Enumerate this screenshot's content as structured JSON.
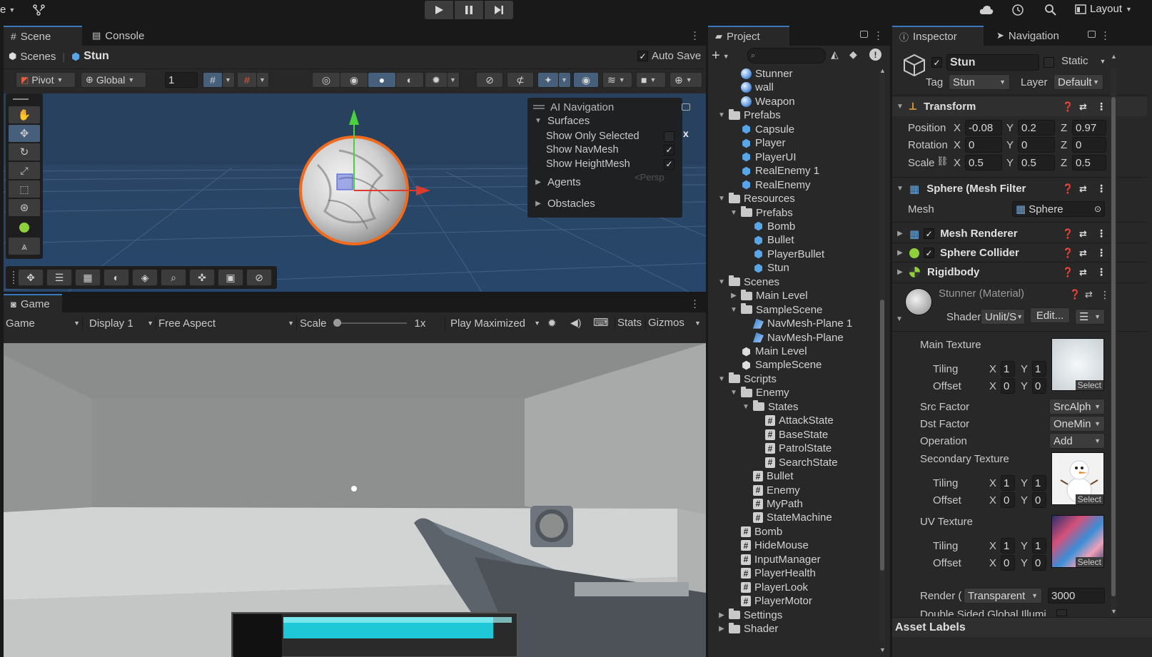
{
  "topbar": {
    "account_menu": "e",
    "layout_label": "Layout"
  },
  "scene_panel": {
    "tabs": [
      {
        "label": "Scene"
      },
      {
        "label": "Console"
      }
    ],
    "breadcrumb_root": "Scenes",
    "breadcrumb_current": "Stun",
    "auto_save_label": "Auto Save",
    "auto_save_checked": true,
    "pivot_label": "Pivot",
    "global_label": "Global",
    "grid_size": "1"
  },
  "ai_navigation": {
    "title": "AI Navigation",
    "surfaces_label": "Surfaces",
    "options": [
      {
        "label": "Show Only Selected",
        "checked": false
      },
      {
        "label": "Show NavMesh",
        "checked": true
      },
      {
        "label": "Show HeightMesh",
        "checked": true
      }
    ],
    "agents_label": "Agents",
    "obstacles_label": "Obstacles",
    "persp_label": "<Persp",
    "close_label": "x"
  },
  "game_panel": {
    "tab_label": "Game",
    "mode": "Game",
    "display": "Display 1",
    "aspect": "Free Aspect",
    "scale_label": "Scale",
    "scale_value": "1x",
    "play_mode": "Play Maximized",
    "stats_label": "Stats",
    "gizmos_label": "Gizmos",
    "health_fraction": 0.92
  },
  "project_panel": {
    "tab_label": "Project",
    "search_placeholder": "",
    "items": [
      {
        "label": "Stunner",
        "icon": "material",
        "depth": 1,
        "arrow": ""
      },
      {
        "label": "wall",
        "icon": "material",
        "depth": 1,
        "arrow": ""
      },
      {
        "label": "Weapon",
        "icon": "material",
        "depth": 1,
        "arrow": ""
      },
      {
        "label": "Prefabs",
        "icon": "folder",
        "depth": 0,
        "arrow": "down"
      },
      {
        "label": "Capsule",
        "icon": "prefab",
        "depth": 1,
        "arrow": ""
      },
      {
        "label": "Player",
        "icon": "prefab",
        "depth": 1,
        "arrow": ""
      },
      {
        "label": "PlayerUI",
        "icon": "prefab",
        "depth": 1,
        "arrow": ""
      },
      {
        "label": "RealEnemy 1",
        "icon": "prefab",
        "depth": 1,
        "arrow": ""
      },
      {
        "label": "RealEnemy",
        "icon": "prefab",
        "depth": 1,
        "arrow": ""
      },
      {
        "label": "Resources",
        "icon": "folder",
        "depth": 0,
        "arrow": "down"
      },
      {
        "label": "Prefabs",
        "icon": "folder",
        "depth": 1,
        "arrow": "down"
      },
      {
        "label": "Bomb",
        "icon": "prefab",
        "depth": 2,
        "arrow": ""
      },
      {
        "label": "Bullet",
        "icon": "prefab",
        "depth": 2,
        "arrow": ""
      },
      {
        "label": "PlayerBullet",
        "icon": "prefab",
        "depth": 2,
        "arrow": ""
      },
      {
        "label": "Stun",
        "icon": "prefab",
        "depth": 2,
        "arrow": ""
      },
      {
        "label": "Scenes",
        "icon": "folder",
        "depth": 0,
        "arrow": "down"
      },
      {
        "label": "Main Level",
        "icon": "folder",
        "depth": 1,
        "arrow": "right"
      },
      {
        "label": "SampleScene",
        "icon": "folder",
        "depth": 1,
        "arrow": "down"
      },
      {
        "label": "NavMesh-Plane 1",
        "icon": "navmesh",
        "depth": 2,
        "arrow": ""
      },
      {
        "label": "NavMesh-Plane",
        "icon": "navmesh",
        "depth": 2,
        "arrow": ""
      },
      {
        "label": "Main Level",
        "icon": "scene",
        "depth": 1,
        "arrow": ""
      },
      {
        "label": "SampleScene",
        "icon": "scene",
        "depth": 1,
        "arrow": ""
      },
      {
        "label": "Scripts",
        "icon": "folder",
        "depth": 0,
        "arrow": "down"
      },
      {
        "label": "Enemy",
        "icon": "folder",
        "depth": 1,
        "arrow": "down"
      },
      {
        "label": "States",
        "icon": "folder",
        "depth": 2,
        "arrow": "down"
      },
      {
        "label": "AttackState",
        "icon": "script",
        "depth": 3,
        "arrow": ""
      },
      {
        "label": "BaseState",
        "icon": "script",
        "depth": 3,
        "arrow": ""
      },
      {
        "label": "PatrolState",
        "icon": "script",
        "depth": 3,
        "arrow": ""
      },
      {
        "label": "SearchState",
        "icon": "script",
        "depth": 3,
        "arrow": ""
      },
      {
        "label": "Bullet",
        "icon": "script",
        "depth": 2,
        "arrow": ""
      },
      {
        "label": "Enemy",
        "icon": "script",
        "depth": 2,
        "arrow": ""
      },
      {
        "label": "MyPath",
        "icon": "script",
        "depth": 2,
        "arrow": ""
      },
      {
        "label": "StateMachine",
        "icon": "script",
        "depth": 2,
        "arrow": ""
      },
      {
        "label": "Bomb",
        "icon": "script",
        "depth": 1,
        "arrow": ""
      },
      {
        "label": "HideMouse",
        "icon": "script",
        "depth": 1,
        "arrow": ""
      },
      {
        "label": "InputManager",
        "icon": "script",
        "depth": 1,
        "arrow": ""
      },
      {
        "label": "PlayerHealth",
        "icon": "script",
        "depth": 1,
        "arrow": ""
      },
      {
        "label": "PlayerLook",
        "icon": "script",
        "depth": 1,
        "arrow": ""
      },
      {
        "label": "PlayerMotor",
        "icon": "script",
        "depth": 1,
        "arrow": ""
      },
      {
        "label": "Settings",
        "icon": "folder",
        "depth": 0,
        "arrow": "right"
      },
      {
        "label": "Shader",
        "icon": "folder",
        "depth": 0,
        "arrow": "right"
      }
    ]
  },
  "inspector": {
    "tabs": [
      {
        "label": "Inspector"
      },
      {
        "label": "Navigation"
      }
    ],
    "object_name": "Stun",
    "object_active": true,
    "static_label": "Static",
    "tag_label": "Tag",
    "tag_value": "Stun",
    "layer_label": "Layer",
    "layer_value": "Default",
    "transform": {
      "title": "Transform",
      "position_label": "Position",
      "rotation_label": "Rotation",
      "scale_label": "Scale",
      "position": {
        "x": "-0.08",
        "y": "0.2",
        "z": "0.97"
      },
      "rotation": {
        "x": "0",
        "y": "0",
        "z": "0"
      },
      "scale": {
        "x": "0.5",
        "y": "0.5",
        "z": "0.5"
      }
    },
    "axis_labels": {
      "x": "X",
      "y": "Y",
      "z": "Z"
    },
    "mesh_filter": {
      "title": "Sphere (Mesh Filter",
      "mesh_label": "Mesh",
      "mesh_value": "Sphere"
    },
    "mesh_renderer": {
      "title": "Mesh Renderer",
      "enabled": true
    },
    "sphere_collider": {
      "title": "Sphere Collider",
      "enabled": true
    },
    "rigidbody": {
      "title": "Rigidbody"
    },
    "material": {
      "name": "Stunner (Material)",
      "shader_label": "Shader",
      "shader_value": "Unlit/S",
      "edit_label": "Edit...",
      "main_texture_label": "Main Texture",
      "tiling_label": "Tiling",
      "offset_label": "Offset",
      "main_tiling": {
        "x": "1",
        "y": "1"
      },
      "main_offset": {
        "x": "0",
        "y": "0"
      },
      "select_label": "Select",
      "src_factor_label": "Src Factor",
      "src_factor_value": "SrcAlph",
      "dst_factor_label": "Dst Factor",
      "dst_factor_value": "OneMin",
      "operation_label": "Operation",
      "operation_value": "Add",
      "secondary_texture_label": "Secondary Texture",
      "secondary_tiling": {
        "x": "1",
        "y": "1"
      },
      "secondary_offset": {
        "x": "0",
        "y": "0"
      },
      "uv_texture_label": "UV Texture",
      "uv_tiling": {
        "x": "1",
        "y": "1"
      },
      "uv_offset": {
        "x": "0",
        "y": "0"
      },
      "render_queue_label": "Render (",
      "render_queue_mode": "Transparent",
      "render_queue_value": "3000",
      "double_sided_label": "Double Sided Global Illumi"
    },
    "asset_labels": "Asset Labels"
  },
  "colors": {
    "accent": "#3a79bb",
    "panel_bg": "#282828",
    "selection_orange": "#f26b1d",
    "health_cyan": "#1ec8d6"
  }
}
